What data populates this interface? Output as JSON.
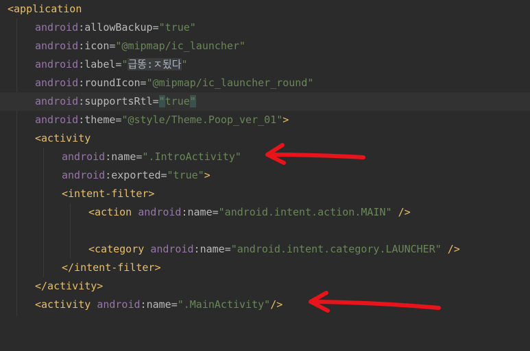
{
  "code": {
    "application_open": "<application",
    "allow_backup": {
      "ns": "android",
      "attr": "allowBackup",
      "value": "\"true\""
    },
    "icon": {
      "ns": "android",
      "attr": "icon",
      "value": "\"@mipmap/ic_launcher\""
    },
    "label": {
      "ns": "android",
      "attr": "label",
      "q1": "\"",
      "folded": "급똥:ㅈ됬다",
      "q2": "\""
    },
    "round_icon": {
      "ns": "android",
      "attr": "roundIcon",
      "value": "\"@mipmap/ic_launcher_round\""
    },
    "supports_rtl": {
      "ns": "android",
      "attr": "supportsRtl",
      "q1": "\"",
      "text": "true",
      "q2": "\""
    },
    "theme": {
      "ns": "android",
      "attr": "theme",
      "value": "\"@style/Theme.Poop_ver_01\"",
      "close": ">"
    },
    "activity_open": "<activity",
    "intro_name": {
      "ns": "android",
      "attr": "name",
      "value": "\".IntroActivity\""
    },
    "exported": {
      "ns": "android",
      "attr": "exported",
      "value": "\"true\"",
      "close": ">"
    },
    "intent_filter_open": "<intent-filter>",
    "action": {
      "tag": "<action",
      "ns": "android",
      "attr": "name",
      "value": "\"android.intent.action.MAIN\"",
      "close": "/>"
    },
    "category": {
      "tag": "<category",
      "ns": "android",
      "attr": "name",
      "value": "\"android.intent.category.LAUNCHER\"",
      "close": "/>"
    },
    "intent_filter_close": "</intent-filter>",
    "activity_close": "</activity>",
    "main_activity": {
      "tag": "<activity",
      "ns": "android",
      "attr": "name",
      "value": "\".MainActivity\"",
      "close": "/>"
    }
  },
  "colors": {
    "background": "#2b2b2b",
    "tag": "#e8bf6a",
    "namespace": "#9876aa",
    "attribute": "#bababa",
    "string": "#6a8759",
    "annotation_arrow": "#e8141c"
  }
}
